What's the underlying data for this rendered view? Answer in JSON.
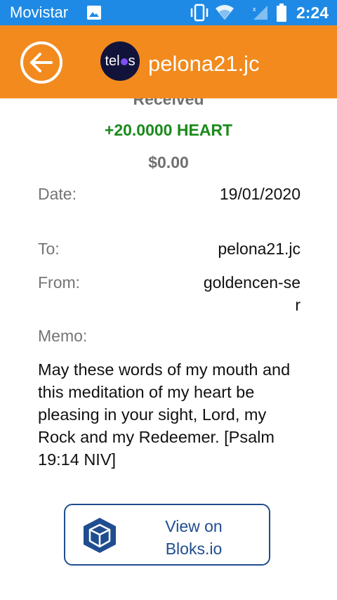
{
  "status_bar": {
    "carrier": "Movistar",
    "time": "2:24",
    "icons": [
      "image-icon",
      "vibrate-icon",
      "wifi-icon",
      "signal-icon",
      "battery-icon"
    ]
  },
  "app_bar": {
    "title": "pelona21.jc",
    "logo_text_left": "tel",
    "logo_text_right": "s",
    "icons": [
      "back-arrow-icon"
    ],
    "colors": {
      "background": "#f28a1e",
      "logo_bg": "#12133a",
      "logo_dot": "#7d4ff5"
    }
  },
  "transaction": {
    "header_cut": "Received",
    "amount": "+20.0000 HEART",
    "usd_value": "$0.00",
    "fields": {
      "date": {
        "label": "Date:",
        "value": "19/01/2020"
      },
      "to": {
        "label": "To:",
        "value": "pelona21.jc"
      },
      "from": {
        "label": "From:",
        "value": "goldencen-ser"
      },
      "memo": {
        "label": "Memo:",
        "value": "May these words of my mouth and this meditation of my heart be pleasing in your sight, Lord, my Rock and my Redeemer. [Psalm 19:14 NIV]"
      }
    },
    "colors": {
      "amount": "#1a8a1a",
      "label": "#757575"
    }
  },
  "bloks_button": {
    "label": "View on Bloks.io",
    "icon": "bloks-cube-icon",
    "color": "#1f4d8f"
  }
}
